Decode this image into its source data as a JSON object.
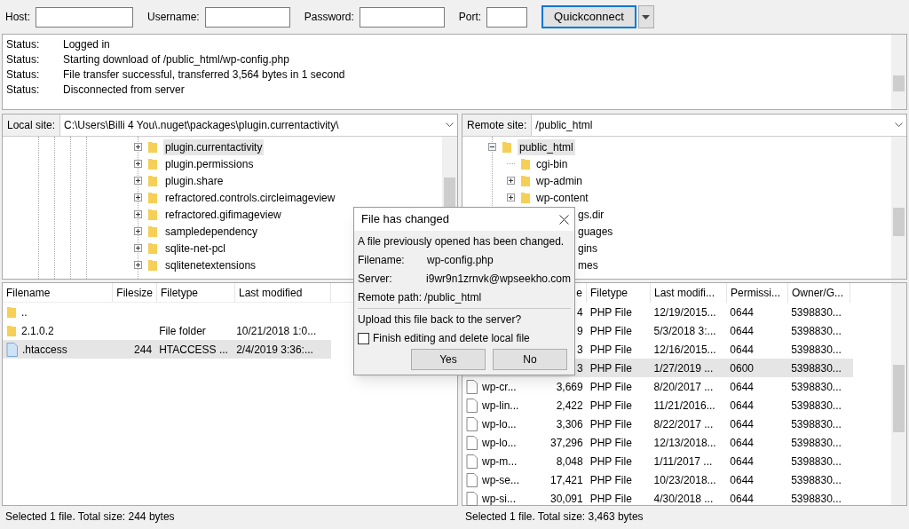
{
  "toolbar": {
    "fields": [
      {
        "label": "Host:"
      },
      {
        "label": "Username:"
      },
      {
        "label": "Password:"
      },
      {
        "label": "Port:"
      }
    ],
    "button": "Quickconnect"
  },
  "log": [
    {
      "label": "Status:",
      "message": "Logged in"
    },
    {
      "label": "Status:",
      "message": "Starting download of /public_html/wp-config.php"
    },
    {
      "label": "Status:",
      "message": "File transfer successful, transferred 3,564 bytes in 1 second"
    },
    {
      "label": "Status:",
      "message": "Disconnected from server"
    }
  ],
  "local": {
    "site_label": "Local site:",
    "path": "C:\\Users\\Billi 4 You\\.nuget\\packages\\plugin.currentactivity\\",
    "tree": [
      {
        "label": "plugin.currentactivity",
        "expanded": false,
        "selected": true
      },
      {
        "label": "plugin.permissions",
        "expanded": false,
        "selected": false
      },
      {
        "label": "plugin.share",
        "expanded": false,
        "selected": false
      },
      {
        "label": "refractored.controls.circleimageview",
        "expanded": false,
        "selected": false
      },
      {
        "label": "refractored.gifimageview",
        "expanded": false,
        "selected": false
      },
      {
        "label": "sampledependency",
        "expanded": false,
        "selected": false
      },
      {
        "label": "sqlite-net-pcl",
        "expanded": false,
        "selected": false
      },
      {
        "label": "sqlitenetextensions",
        "expanded": false,
        "selected": false
      }
    ],
    "columns": [
      "Filename",
      "Filesize",
      "Filetype",
      "Last modified"
    ],
    "files": [
      {
        "kind": "folder",
        "name": "..",
        "selected": false
      },
      {
        "kind": "folder",
        "name": "2.1.0.2",
        "type": "File folder",
        "modified": "10/21/2018 1:0...",
        "selected": false
      },
      {
        "kind": "file",
        "name": ".htaccess",
        "size": "244",
        "type": "HTACCESS ...",
        "modified": "2/4/2019 3:36:...",
        "selected": true
      }
    ],
    "status": "Selected 1 file. Total size: 244 bytes"
  },
  "remote": {
    "site_label": "Remote site:",
    "path": "/public_html",
    "tree": [
      {
        "label": "public_html",
        "expanded": true,
        "selected": true,
        "children": [
          {
            "kind": "leaf",
            "label": "cgi-bin"
          },
          {
            "kind": "collapsed",
            "label": "wp-admin"
          },
          {
            "kind": "collapsed",
            "label": "wp-content"
          },
          {
            "kind": "partial",
            "label": "gs.dir"
          },
          {
            "kind": "partial",
            "label": "guages"
          },
          {
            "kind": "partial",
            "label": "gins"
          },
          {
            "kind": "partial",
            "label": "mes"
          }
        ]
      }
    ],
    "columns": [
      "e",
      "Filetype",
      "Last modifi...",
      "Permissi...",
      "Owner/G..."
    ],
    "files": [
      {
        "size": "4",
        "type": "PHP File",
        "modified": "12/19/2015...",
        "perms": "0644",
        "owner": "5398830...",
        "selected": false
      },
      {
        "size": "9",
        "type": "PHP File",
        "modified": "5/3/2018 3:...",
        "perms": "0644",
        "owner": "5398830...",
        "selected": false
      },
      {
        "size": "3",
        "type": "PHP File",
        "modified": "12/16/2015...",
        "perms": "0644",
        "owner": "5398830...",
        "selected": false
      },
      {
        "size": "3",
        "type": "PHP File",
        "modified": "1/27/2019 ...",
        "perms": "0600",
        "owner": "5398830...",
        "selected": true
      },
      {
        "name": "wp-cr...",
        "size": "3,669",
        "type": "PHP File",
        "modified": "8/20/2017 ...",
        "perms": "0644",
        "owner": "5398830...",
        "selected": false
      },
      {
        "name": "wp-lin...",
        "size": "2,422",
        "type": "PHP File",
        "modified": "11/21/2016...",
        "perms": "0644",
        "owner": "5398830...",
        "selected": false
      },
      {
        "name": "wp-lo...",
        "size": "3,306",
        "type": "PHP File",
        "modified": "8/22/2017 ...",
        "perms": "0644",
        "owner": "5398830...",
        "selected": false
      },
      {
        "name": "wp-lo...",
        "size": "37,296",
        "type": "PHP File",
        "modified": "12/13/2018...",
        "perms": "0644",
        "owner": "5398830...",
        "selected": false
      },
      {
        "name": "wp-m...",
        "size": "8,048",
        "type": "PHP File",
        "modified": "1/11/2017 ...",
        "perms": "0644",
        "owner": "5398830...",
        "selected": false
      },
      {
        "name": "wp-se...",
        "size": "17,421",
        "type": "PHP File",
        "modified": "10/23/2018...",
        "perms": "0644",
        "owner": "5398830...",
        "selected": false
      },
      {
        "name": "wp-si...",
        "size": "30,091",
        "type": "PHP File",
        "modified": "4/30/2018 ...",
        "perms": "0644",
        "owner": "5398830...",
        "selected": false
      }
    ],
    "status": "Selected 1 file. Total size: 3,463 bytes"
  },
  "dialog": {
    "title": "File has changed",
    "message": "A file previously opened has been changed.",
    "details": [
      {
        "label": "Filename:",
        "value": "wp-config.php"
      },
      {
        "label": "Server:",
        "value": "i9wr9n1zrnvk@wpseekho.com"
      },
      {
        "label": "Remote path:",
        "value": "/public_html"
      }
    ],
    "question": "Upload this file back to the server?",
    "checkbox": {
      "label": "Finish editing and delete local file",
      "checked": false
    },
    "buttons": [
      "Yes",
      "No"
    ]
  }
}
